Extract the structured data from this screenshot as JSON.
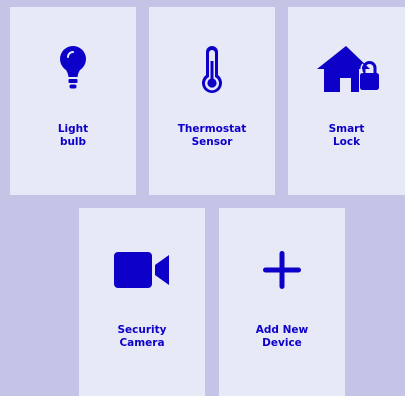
{
  "theme": {
    "background": "#c3c4e6",
    "card": "#e8e9f6",
    "accent": "#0d00c9"
  },
  "devices": [
    {
      "label": "Light\nbulb",
      "icon": "lightbulb-icon"
    },
    {
      "label": "Thermostat\nSensor",
      "icon": "thermometer-icon"
    },
    {
      "label": "Smart\nLock",
      "icon": "house-lock-icon"
    },
    {
      "label": "Security\nCamera",
      "icon": "video-camera-icon"
    }
  ],
  "add_device": {
    "label": "Add New\nDevice",
    "icon": "plus-icon"
  }
}
